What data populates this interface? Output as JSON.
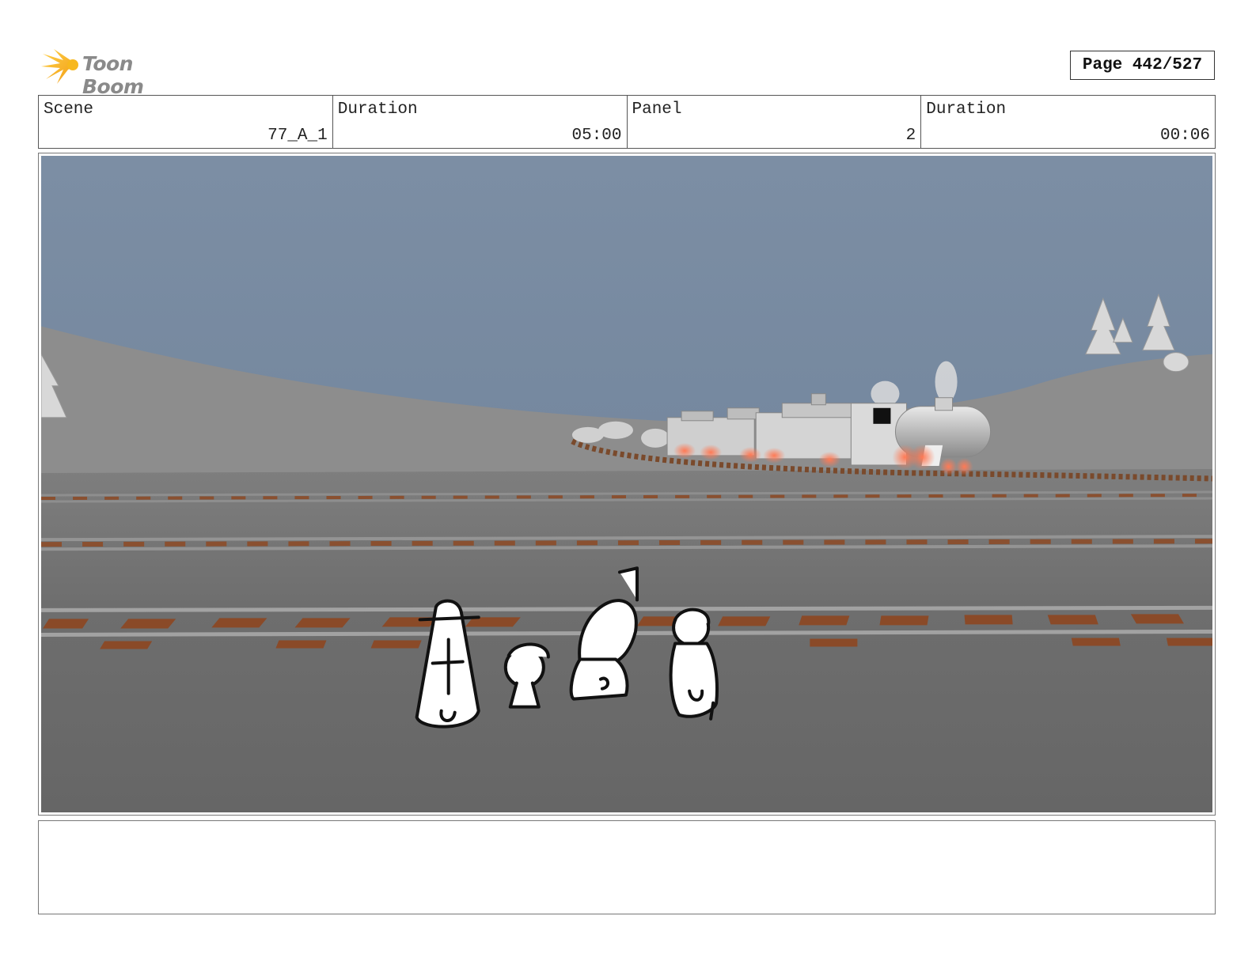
{
  "header": {
    "logo_text": "Toon Boom",
    "page_label": "Page 442/527"
  },
  "info": {
    "scene_label": "Scene",
    "scene_value": "77_A_1",
    "duration_label": "Duration",
    "duration_value": "05:00",
    "panel_label": "Panel",
    "panel_value": "2",
    "panel_duration_label": "Duration",
    "panel_duration_value": "00:06"
  },
  "notes": {
    "text": ""
  },
  "colors": {
    "sky": "#7d8fa3",
    "ground": "#6a6a6a",
    "hill": "#8c8c8c",
    "tie": "#8a5030",
    "glow": "#ff6040",
    "logo_star": "#f5b51e"
  }
}
